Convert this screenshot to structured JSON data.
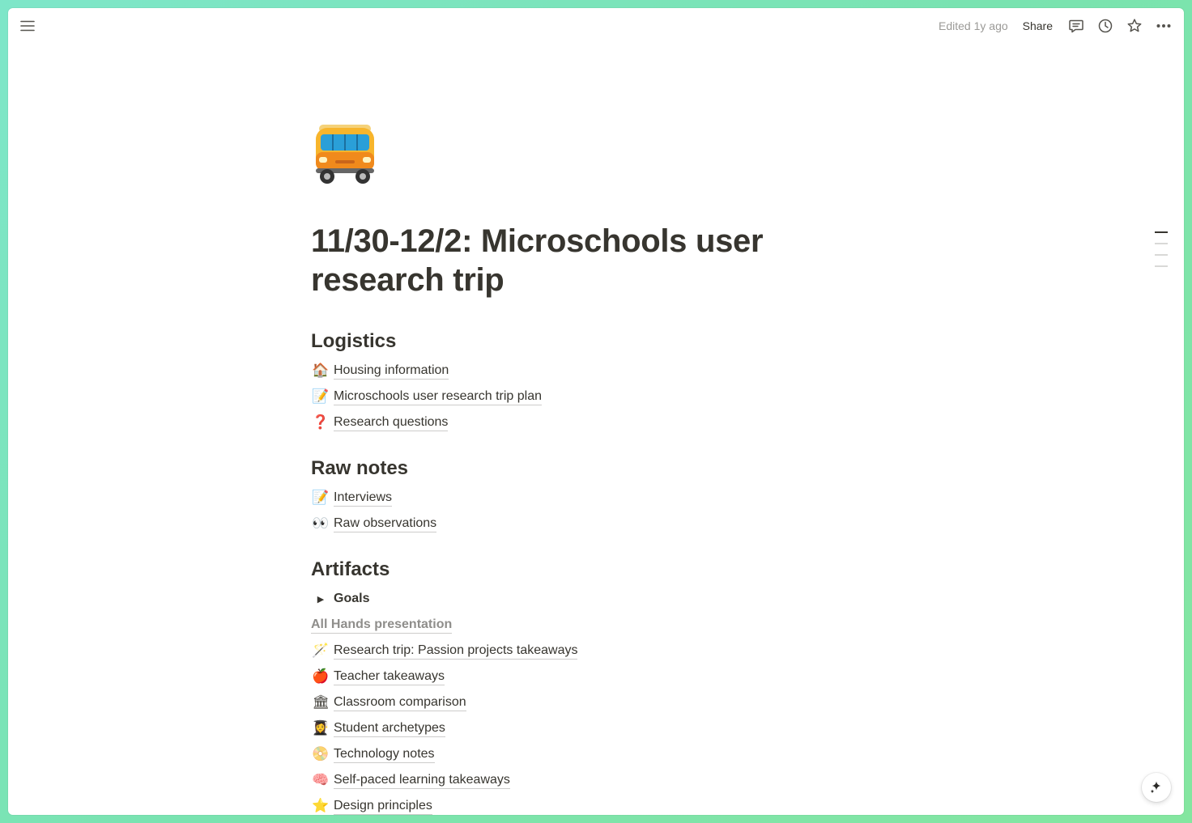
{
  "topbar": {
    "edited": "Edited 1y ago",
    "share_label": "Share",
    "icons": [
      "menu-icon",
      "comment-icon",
      "history-icon",
      "star-icon",
      "more-icon"
    ]
  },
  "page": {
    "icon": "bus-icon",
    "title": "11/30-12/2: Microschools user research trip"
  },
  "sections": {
    "logistics": {
      "heading": "Logistics",
      "items": [
        {
          "emoji": "🏠",
          "label": "Housing information"
        },
        {
          "emoji": "📝",
          "label": "Microschools user research trip plan"
        },
        {
          "emoji": "❓",
          "label": "Research questions"
        }
      ]
    },
    "raw_notes": {
      "heading": "Raw notes",
      "items": [
        {
          "emoji": "📝",
          "label": "Interviews"
        },
        {
          "emoji": "👀",
          "label": "Raw observations"
        }
      ]
    },
    "artifacts": {
      "heading": "Artifacts",
      "toggle": {
        "label": "Goals"
      },
      "muted_link": "All Hands presentation",
      "items": [
        {
          "emoji": "🪄",
          "label": "Research trip: Passion projects takeaways"
        },
        {
          "emoji": "🍎",
          "label": "Teacher takeaways"
        },
        {
          "emoji": "🏛",
          "label": "Classroom comparison"
        },
        {
          "emoji": "👩‍🎓",
          "label": "Student archetypes"
        },
        {
          "emoji": "📀",
          "label": "Technology notes"
        },
        {
          "emoji": "🧠",
          "label": "Self-paced learning takeaways"
        },
        {
          "emoji": "⭐",
          "label": "Design principles"
        }
      ]
    }
  }
}
